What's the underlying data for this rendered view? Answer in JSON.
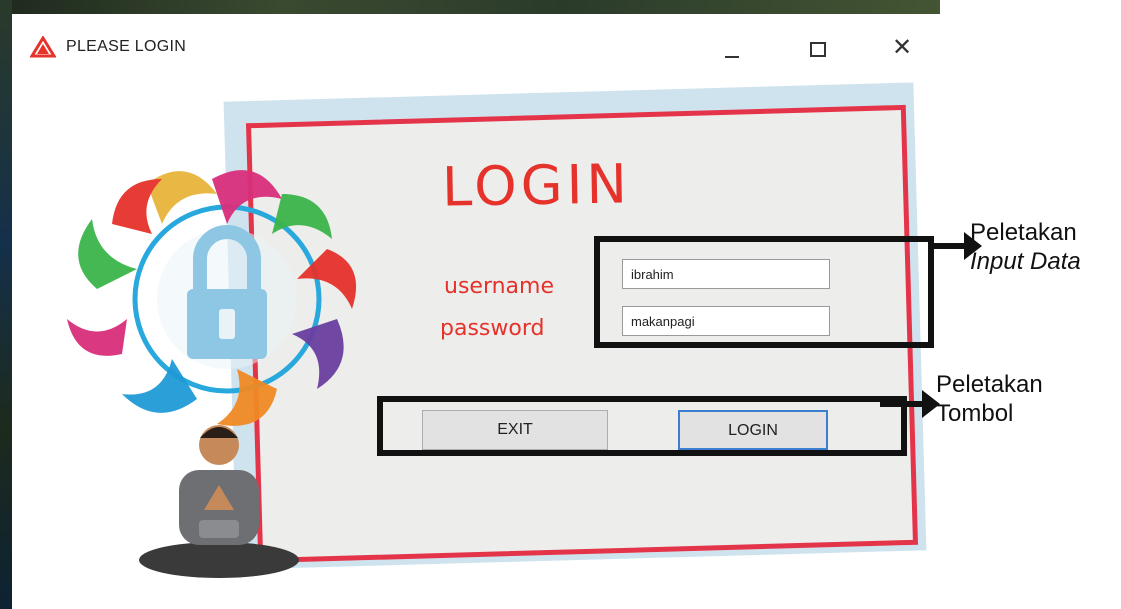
{
  "window": {
    "title": "PLEASE LOGIN",
    "controls": {
      "minimize": "minimize",
      "maximize": "maximize",
      "close": "✕"
    }
  },
  "form": {
    "heading": "LOGIN",
    "username_label": "username",
    "password_label": "password",
    "username_value": "ibrahim",
    "password_value": "makanpagi",
    "exit_label": "EXIT",
    "login_label": "LOGIN"
  },
  "annotations": {
    "input_note_line1": "Peletakan",
    "input_note_line2": "Input Data",
    "button_note_line1": "Peletakan",
    "button_note_line2": "Tombol"
  },
  "colors": {
    "accent_red": "#e5322b",
    "frame_red": "#e3344a",
    "frame_blue": "#cfe3ee",
    "highlight": "#111111",
    "focus_blue": "#3c7fd0"
  },
  "icons": {
    "app": "warning-triangle-icon",
    "emblem": "padlock-emblem-icon",
    "person": "person-illustration"
  }
}
